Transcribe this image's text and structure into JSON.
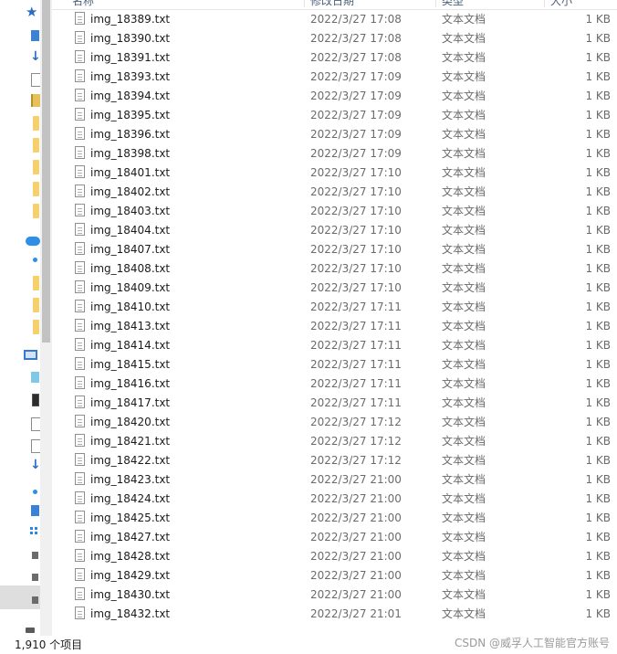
{
  "columns": {
    "name": "名称",
    "date": "修改日期",
    "type": "类型",
    "size": "大小"
  },
  "files": [
    {
      "name": "img_18389.txt",
      "date": "2022/3/27 17:08",
      "type": "文本文档",
      "size": "1 KB"
    },
    {
      "name": "img_18390.txt",
      "date": "2022/3/27 17:08",
      "type": "文本文档",
      "size": "1 KB"
    },
    {
      "name": "img_18391.txt",
      "date": "2022/3/27 17:08",
      "type": "文本文档",
      "size": "1 KB"
    },
    {
      "name": "img_18393.txt",
      "date": "2022/3/27 17:09",
      "type": "文本文档",
      "size": "1 KB"
    },
    {
      "name": "img_18394.txt",
      "date": "2022/3/27 17:09",
      "type": "文本文档",
      "size": "1 KB"
    },
    {
      "name": "img_18395.txt",
      "date": "2022/3/27 17:09",
      "type": "文本文档",
      "size": "1 KB"
    },
    {
      "name": "img_18396.txt",
      "date": "2022/3/27 17:09",
      "type": "文本文档",
      "size": "1 KB"
    },
    {
      "name": "img_18398.txt",
      "date": "2022/3/27 17:09",
      "type": "文本文档",
      "size": "1 KB"
    },
    {
      "name": "img_18401.txt",
      "date": "2022/3/27 17:10",
      "type": "文本文档",
      "size": "1 KB"
    },
    {
      "name": "img_18402.txt",
      "date": "2022/3/27 17:10",
      "type": "文本文档",
      "size": "1 KB"
    },
    {
      "name": "img_18403.txt",
      "date": "2022/3/27 17:10",
      "type": "文本文档",
      "size": "1 KB"
    },
    {
      "name": "img_18404.txt",
      "date": "2022/3/27 17:10",
      "type": "文本文档",
      "size": "1 KB"
    },
    {
      "name": "img_18407.txt",
      "date": "2022/3/27 17:10",
      "type": "文本文档",
      "size": "1 KB"
    },
    {
      "name": "img_18408.txt",
      "date": "2022/3/27 17:10",
      "type": "文本文档",
      "size": "1 KB"
    },
    {
      "name": "img_18409.txt",
      "date": "2022/3/27 17:10",
      "type": "文本文档",
      "size": "1 KB"
    },
    {
      "name": "img_18410.txt",
      "date": "2022/3/27 17:11",
      "type": "文本文档",
      "size": "1 KB"
    },
    {
      "name": "img_18413.txt",
      "date": "2022/3/27 17:11",
      "type": "文本文档",
      "size": "1 KB"
    },
    {
      "name": "img_18414.txt",
      "date": "2022/3/27 17:11",
      "type": "文本文档",
      "size": "1 KB"
    },
    {
      "name": "img_18415.txt",
      "date": "2022/3/27 17:11",
      "type": "文本文档",
      "size": "1 KB"
    },
    {
      "name": "img_18416.txt",
      "date": "2022/3/27 17:11",
      "type": "文本文档",
      "size": "1 KB"
    },
    {
      "name": "img_18417.txt",
      "date": "2022/3/27 17:11",
      "type": "文本文档",
      "size": "1 KB"
    },
    {
      "name": "img_18420.txt",
      "date": "2022/3/27 17:12",
      "type": "文本文档",
      "size": "1 KB"
    },
    {
      "name": "img_18421.txt",
      "date": "2022/3/27 17:12",
      "type": "文本文档",
      "size": "1 KB"
    },
    {
      "name": "img_18422.txt",
      "date": "2022/3/27 17:12",
      "type": "文本文档",
      "size": "1 KB"
    },
    {
      "name": "img_18423.txt",
      "date": "2022/3/27 21:00",
      "type": "文本文档",
      "size": "1 KB"
    },
    {
      "name": "img_18424.txt",
      "date": "2022/3/27 21:00",
      "type": "文本文档",
      "size": "1 KB"
    },
    {
      "name": "img_18425.txt",
      "date": "2022/3/27 21:00",
      "type": "文本文档",
      "size": "1 KB"
    },
    {
      "name": "img_18427.txt",
      "date": "2022/3/27 21:00",
      "type": "文本文档",
      "size": "1 KB"
    },
    {
      "name": "img_18428.txt",
      "date": "2022/3/27 21:00",
      "type": "文本文档",
      "size": "1 KB"
    },
    {
      "name": "img_18429.txt",
      "date": "2022/3/27 21:00",
      "type": "文本文档",
      "size": "1 KB"
    },
    {
      "name": "img_18430.txt",
      "date": "2022/3/27 21:00",
      "type": "文本文档",
      "size": "1 KB"
    },
    {
      "name": "img_18432.txt",
      "date": "2022/3/27 21:01",
      "type": "文本文档",
      "size": "1 KB"
    }
  ],
  "status_bar": {
    "item_count": "1,910 个项目",
    "watermark": "CSDN @威孚人工智能官方账号"
  },
  "nav_icons": [
    "star-icon",
    "blue-square-icon",
    "down-arrow-icon",
    "document-icon",
    "folder-document-icon",
    "folder-icon",
    "folder-icon",
    "folder-icon",
    "folder-icon",
    "folder-icon",
    "cloud-icon",
    "person-icon",
    "folder-icon",
    "folder-icon",
    "folder-icon",
    "monitor-icon",
    "3d-objects-icon",
    "video-icon",
    "picture-icon",
    "document-icon",
    "download-icon",
    "music-icon",
    "desktop-icon",
    "grid-icon",
    "drive-icon",
    "drive-icon",
    "drive-icon",
    "drive-icon"
  ],
  "colors": {
    "accent": "#2a6cc4",
    "folder": "#f6d06a",
    "header_text": "#4c607a",
    "secondary_text": "#6b6b6b"
  }
}
